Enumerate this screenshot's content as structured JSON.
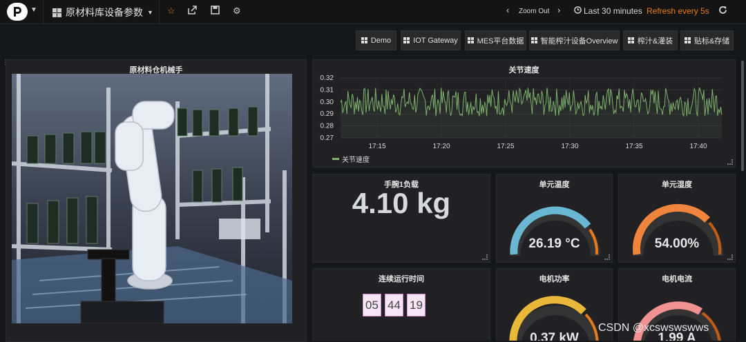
{
  "topbar": {
    "dashboard_title": "原材料库设备参数",
    "zoom_out": "Zoom Out",
    "time_range": "Last 30 minutes",
    "refresh": "Refresh every 5s"
  },
  "nav": [
    "Demo",
    "IOT Gateway",
    "MES平台数据",
    "智能榨汁设备Overview",
    "榨汁&灌装",
    "贴标&存储"
  ],
  "panels": {
    "robot": {
      "title": "原材料仓机械手"
    },
    "joint_speed": {
      "title": "关节速度",
      "legend": "关节速度"
    },
    "load": {
      "title": "手腕1负载",
      "value": "4.10 kg"
    },
    "temp": {
      "title": "单元温度",
      "value": "26.19 °C"
    },
    "humidity": {
      "title": "单元湿度",
      "value": "54.00%"
    },
    "runtime": {
      "title": "连续运行时间",
      "digits": [
        "05",
        "44",
        "19"
      ]
    },
    "power": {
      "title": "电机功率",
      "value": "0.37 kW"
    },
    "current": {
      "title": "电机电流",
      "value": "1.99 A"
    }
  },
  "chart_data": {
    "type": "line",
    "title": "关节速度",
    "x_ticks": [
      "17:15",
      "17:20",
      "17:25",
      "17:30",
      "17:35",
      "17:40"
    ],
    "y_ticks": [
      "0.32",
      "0.31",
      "0.30",
      "0.29",
      "0.28",
      "0.27"
    ],
    "ylim": [
      0.27,
      0.32
    ],
    "series": [
      {
        "name": "关节速度",
        "color": "#7eb26d",
        "mean": 0.3,
        "range": [
          0.288,
          0.312
        ]
      }
    ]
  },
  "watermark": "CSDN @xcswswswws"
}
